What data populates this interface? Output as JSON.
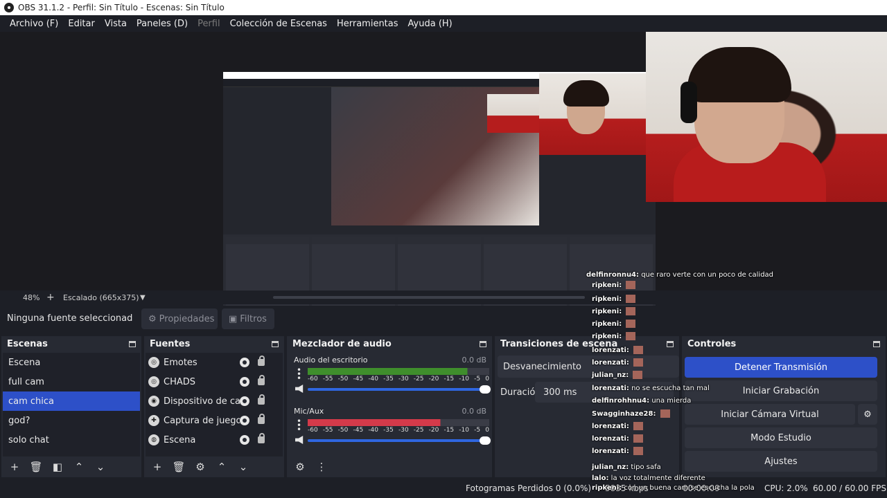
{
  "window": {
    "title": "OBS 31.1.2 - Perfil: Sin Título - Escenas: Sin Título"
  },
  "menu": [
    {
      "label": "Archivo (F)",
      "disabled": false
    },
    {
      "label": "Editar",
      "disabled": false
    },
    {
      "label": "Vista",
      "disabled": false
    },
    {
      "label": "Paneles (D)",
      "disabled": false
    },
    {
      "label": "Perfil",
      "disabled": true
    },
    {
      "label": "Colección de Escenas",
      "disabled": false
    },
    {
      "label": "Herramientas",
      "disabled": false
    },
    {
      "label": "Ayuda (H)",
      "disabled": false
    }
  ],
  "zoom": {
    "percent": "48%",
    "plus": "+",
    "scaling": "Escalado (665x375)"
  },
  "source_toolbar": {
    "no_selection": "Ninguna fuente seleccionad",
    "properties": "Propiedades",
    "filters": "Filtros"
  },
  "scenes": {
    "title": "Escenas",
    "items": [
      "Escena",
      "full cam",
      "cam chica",
      "god?",
      "solo chat"
    ],
    "selected": 2
  },
  "sources": {
    "title": "Fuentes",
    "items": [
      {
        "label": "Emotes",
        "icon": "globe-icon"
      },
      {
        "label": "CHADS",
        "icon": "globe-icon"
      },
      {
        "label": "Dispositivo de capt",
        "icon": "camera-icon"
      },
      {
        "label": "Captura de juego",
        "icon": "gamepad-icon"
      },
      {
        "label": "Escena",
        "icon": "scene-icon"
      }
    ]
  },
  "mixer": {
    "title": "Mezclador de audio",
    "scale": [
      "-60",
      "-55",
      "-50",
      "-45",
      "-40",
      "-35",
      "-30",
      "-25",
      "-20",
      "-15",
      "-10",
      "-5",
      "0"
    ],
    "channels": [
      {
        "name": "Audio del escritorio",
        "db": "0.0 dB",
        "color": "#3f8e2c",
        "level": 0.88
      },
      {
        "name": "Mic/Aux",
        "db": "0.0 dB",
        "color": "#d43a4a",
        "level": 0.73
      }
    ]
  },
  "transitions": {
    "title": "Transiciones de escena",
    "selected": "Desvanecimiento",
    "duration_label": "Duración",
    "duration_value": "300 ms"
  },
  "controls": {
    "title": "Controles",
    "buttons": [
      "Detener Transmisión",
      "Iniciar Grabación",
      "Iniciar Cámara Virtual",
      "Modo Estudio",
      "Ajustes"
    ]
  },
  "status": {
    "dropped": "Fotogramas Perdidos 0 (0.0%)",
    "cpu": "CPU: 2.0%",
    "fps": "60.00 / 60.00 FPS",
    "kbps": "5835 kbps",
    "time": "00:00:09"
  },
  "chat": [
    {
      "user": "delfinronnu4:",
      "text": "que raro verte con un poco de calidad"
    },
    {
      "user": "ripkeni:",
      "text": ""
    },
    {
      "user": "ripkeni:",
      "text": ""
    },
    {
      "user": "ripkeni:",
      "text": ""
    },
    {
      "user": "ripkeni:",
      "text": ""
    },
    {
      "user": "ripkeni:",
      "text": ""
    },
    {
      "user": "lorenzati:",
      "text": ""
    },
    {
      "user": "lorenzati:",
      "text": ""
    },
    {
      "user": "julian_nz:",
      "text": ""
    },
    {
      "user": "lorenzati:",
      "text": "no se escucha tan mal"
    },
    {
      "user": "delfinrohhnu4:",
      "text": "una mierda"
    },
    {
      "user": "Swagginhaze28:",
      "text": ""
    },
    {
      "user": "lorenzati:",
      "text": ""
    },
    {
      "user": "lorenzati:",
      "text": ""
    },
    {
      "user": "lorenzati:",
      "text": ""
    },
    {
      "user": "julian_nz:",
      "text": "tipo safa"
    },
    {
      "user": "lalo:",
      "text": "la voz totalmente diferente"
    },
    {
      "user": "ripkeni:",
      "text": "con un buena cam se escucha la pola"
    }
  ]
}
